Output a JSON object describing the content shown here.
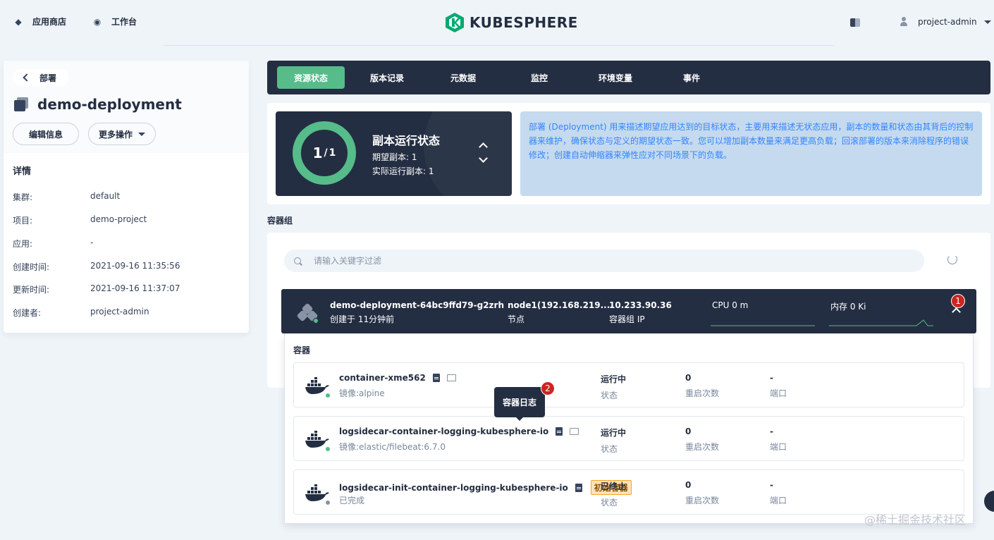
{
  "header": {
    "nav": [
      {
        "label": "应用商店",
        "icon": "app-store-icon"
      },
      {
        "label": "工作台",
        "icon": "workbench-icon"
      }
    ],
    "logo_text": "KUBESPHERE",
    "user": "project-admin"
  },
  "left": {
    "back_label": "部署",
    "title": "demo-deployment",
    "edit_label": "编辑信息",
    "more_label": "更多操作",
    "details_title": "详情",
    "details": [
      {
        "key": "集群:",
        "value": "default"
      },
      {
        "key": "项目:",
        "value": "demo-project"
      },
      {
        "key": "应用:",
        "value": "-"
      },
      {
        "key": "创建时间:",
        "value": "2021-09-16 11:35:56"
      },
      {
        "key": "更新时间:",
        "value": "2021-09-16 11:37:07"
      },
      {
        "key": "创建者:",
        "value": "project-admin"
      }
    ]
  },
  "tabs": [
    "资源状态",
    "版本记录",
    "元数据",
    "监控",
    "环境变量",
    "事件"
  ],
  "status": {
    "current": "1",
    "total": "1",
    "title": "副本运行状态",
    "desired": "期望副本: 1",
    "running": "实际运行副本: 1",
    "ring_fraction": 1.0,
    "description": "部署 (Deployment) 用来描述期望应用达到的目标状态，主要用来描述无状态应用，副本的数量和状态由其背后的控制器来维护，确保状态与定义的期望状态一致。您可以增加副本数量来满足更高负载；回滚部署的版本来消除程序的错误修改；创建自动伸缩器来弹性应对不同场景下的负载。"
  },
  "pods_section": {
    "label": "容器组",
    "search_placeholder": "请输入关键字过滤"
  },
  "pod": {
    "name": "demo-deployment-64bc9ffd79-g2zrh",
    "created": "创建于 11分钟前",
    "node": "node1(192.168.219....",
    "node_label": "节点",
    "ip": "10.233.90.36",
    "ip_label": "容器组 IP",
    "cpu": "CPU 0 m",
    "memory": "内存 0 Ki",
    "badge": "1",
    "status_color": "#55bc8a"
  },
  "containers": {
    "label": "容器",
    "items": [
      {
        "name": "container-xme562",
        "image": "镜像:alpine",
        "status": "运行中",
        "status_label": "状态",
        "restarts": "0",
        "restarts_label": "重启次数",
        "port": "-",
        "port_label": "端口",
        "tag": "",
        "dot_color": "#55bc8a"
      },
      {
        "name": "logsidecar-container-logging-kubesphere-io",
        "image": "镜像:elastic/filebeat:6.7.0",
        "status": "运行中",
        "status_label": "状态",
        "restarts": "0",
        "restarts_label": "重启次数",
        "port": "-",
        "port_label": "端口",
        "tag": "",
        "dot_color": "#55bc8a"
      },
      {
        "name": "logsidecar-init-container-logging-kubesphere-io",
        "image": "已完成",
        "status": "已终止",
        "status_label": "状态",
        "restarts": "0",
        "restarts_label": "重启次数",
        "port": "-",
        "port_label": "端口",
        "tag": "初始容器",
        "dot_color": "#8893a5"
      }
    ],
    "tooltip": "容器日志",
    "tooltip_badge": "2"
  },
  "watermark": "@稀土掘金技术社区",
  "colors": {
    "accent": "#55bc8a",
    "dark": "#242e42",
    "info_bg": "#c5daee",
    "info_text": "#3385ff",
    "badge": "#ca2621"
  }
}
